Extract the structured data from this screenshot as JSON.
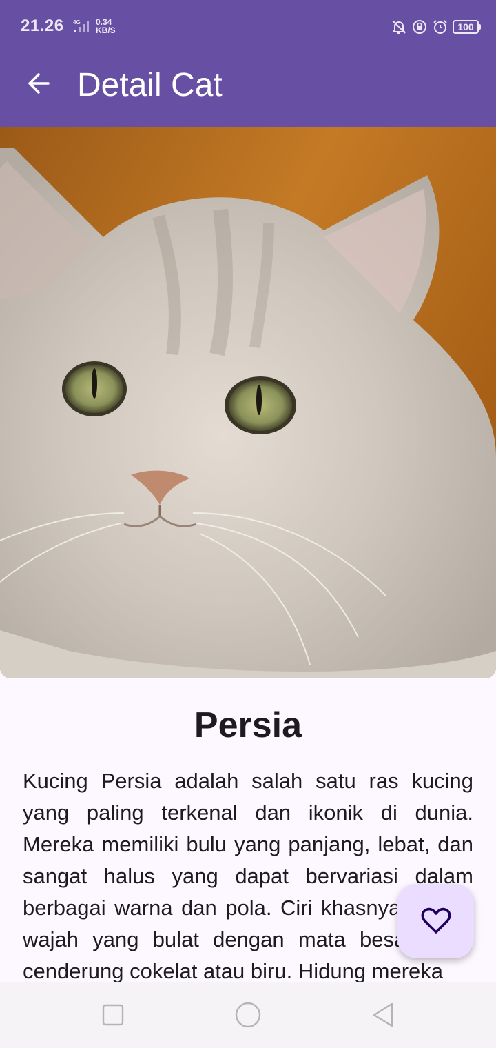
{
  "status_bar": {
    "time": "21.26",
    "network": "4G",
    "speed_value": "0.34",
    "speed_unit": "KB/S",
    "battery": "100",
    "icons": [
      "bell-off-icon",
      "lock-rotation-icon",
      "alarm-icon",
      "battery-icon"
    ]
  },
  "app_bar": {
    "title": "Detail Cat",
    "back_icon": "arrow-left-icon"
  },
  "hero_image": {
    "subject": "Persian cat photo"
  },
  "detail": {
    "name": "Persia",
    "description": "Kucing Persia adalah salah satu ras kucing yang paling terkenal dan ikonik di dunia. Mereka memiliki bulu yang panjang, lebat, dan sangat halus yang dapat bervariasi dalam berbagai warna dan pola. Ciri khasnya adalah wajah yang bulat dengan mata besar yang cenderung cokelat atau biru. Hidung mereka"
  },
  "fab": {
    "icon": "heart-outline-icon"
  },
  "nav_bar": {
    "items": [
      "recents-icon",
      "home-icon",
      "back-icon"
    ]
  },
  "colors": {
    "primary": "#6750a4",
    "fab_background": "#eaddff",
    "fab_icon": "#21005d",
    "surface": "#fdf7ff"
  }
}
